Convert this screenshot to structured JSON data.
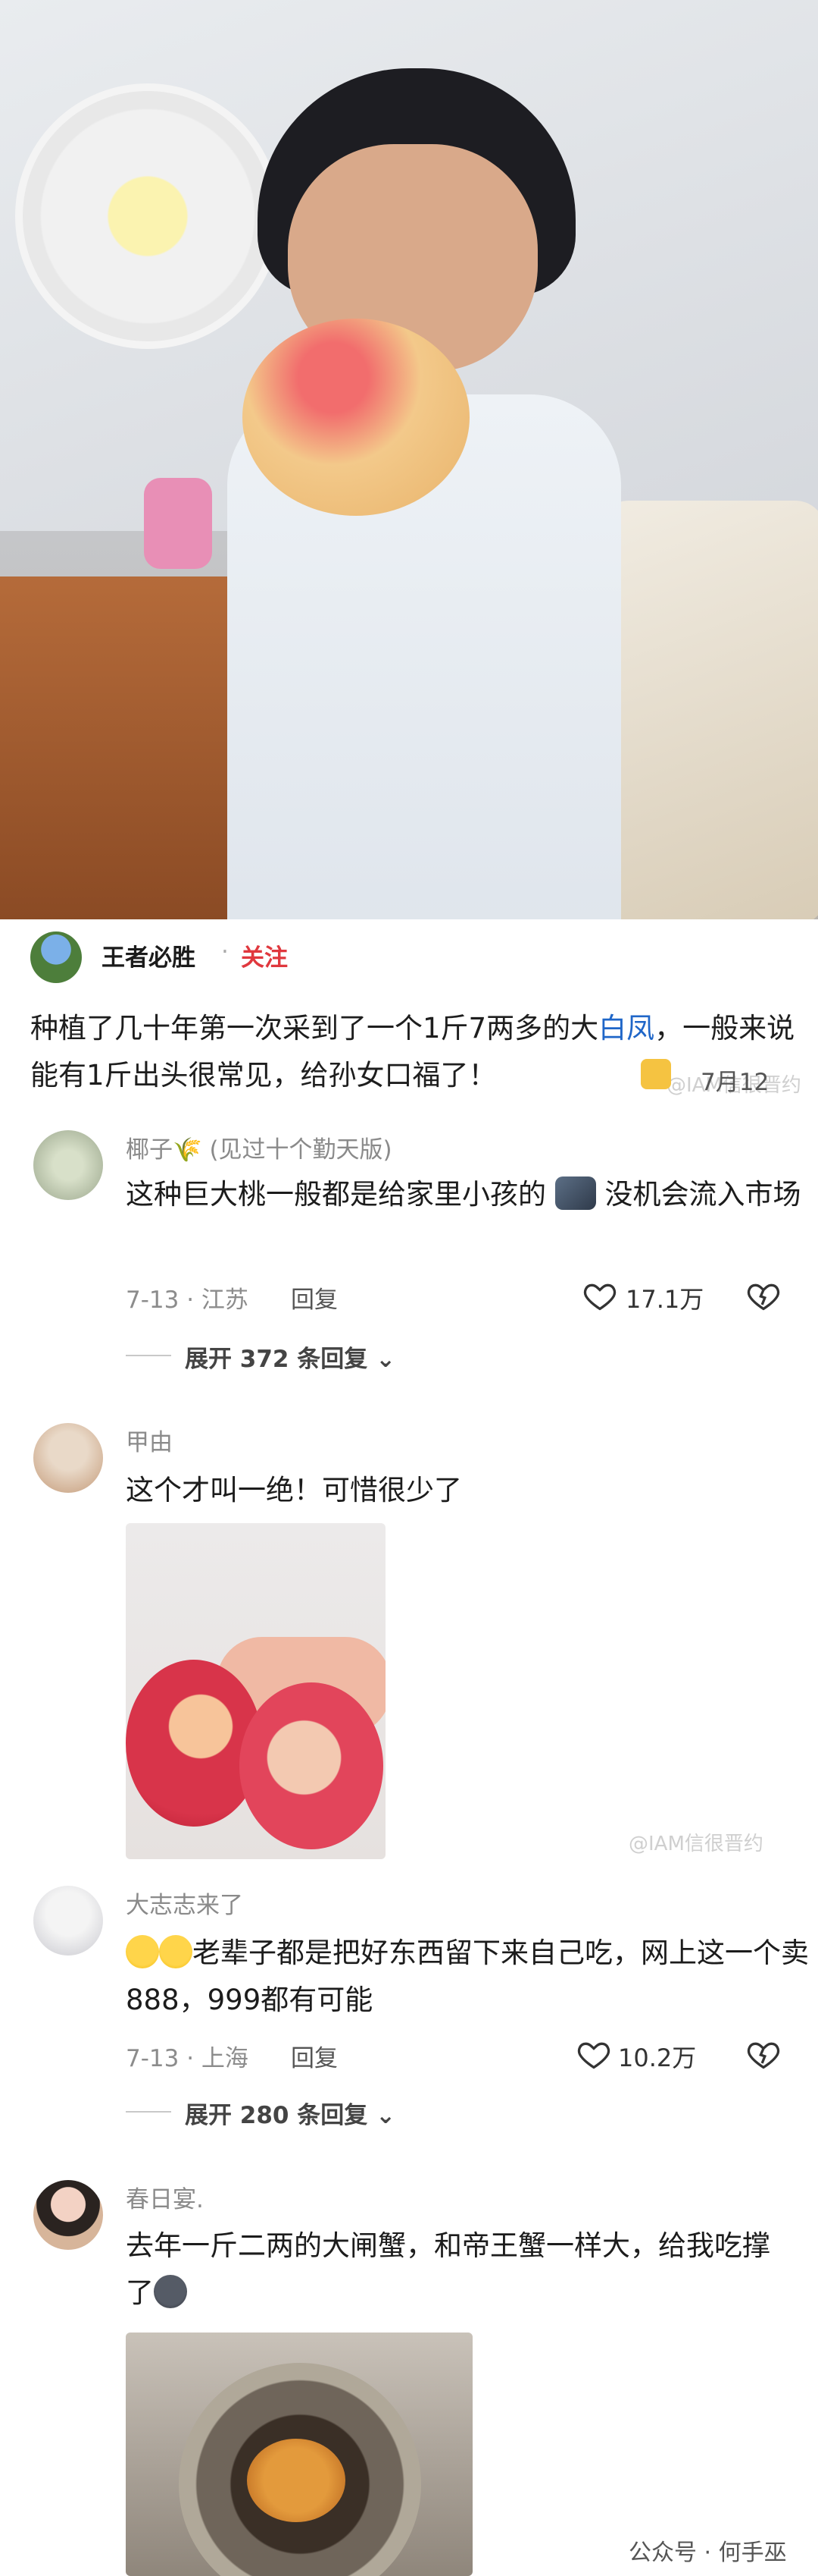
{
  "post": {
    "author": "王者必胜",
    "separator": "·",
    "follow_label": "关注",
    "text_before_link": "种植了几十年第一次采到了一个1斤7两多的大",
    "text_link": "白凤",
    "text_after_link": "，一般来说能有1斤出头很常见，给孙女口福了！",
    "date": "7月12"
  },
  "comments": [
    {
      "name": "椰子🌾 (见过十个勤天版)",
      "text": "这种巨大桃一般都是给家里小孩的",
      "text2": "没机会流入市场",
      "meta": "7-13 · 江苏",
      "reply": "回复",
      "likes": "17.1万",
      "expand": "展开 372 条回复",
      "chevron": "⌄"
    },
    {
      "name": "甲由",
      "text": "这个才叫一绝！可惜很少了",
      "image_watermark": "@IAM信很晋约"
    },
    {
      "name": "大志志来了",
      "text": "老辈子都是把好东西留下来自己吃，网上这一个卖888，999都有可能",
      "meta": "7-13 · 上海",
      "reply": "回复",
      "likes": "10.2万",
      "expand": "展开 280 条回复",
      "chevron": "⌄"
    },
    {
      "name": "春日宴.",
      "text": "去年一斤二两的大闸蟹，和帝王蟹一样大，给我吃撑了"
    }
  ],
  "watermarks": {
    "post": "@IAM信很晋约",
    "footer": "公众号 · 何手巫"
  },
  "colors": {
    "accent_follow": "#e0383e",
    "link": "#1f66c8"
  }
}
